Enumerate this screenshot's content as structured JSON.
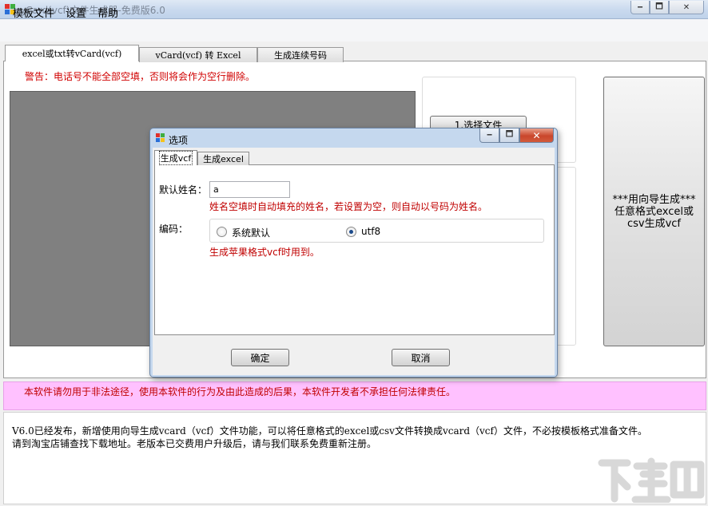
{
  "app": {
    "title": "vCard(vcf)文件生成器-免费版6.0"
  },
  "titlebar_buttons": {
    "minimize": "🗕",
    "maximize": "🗖",
    "close": "✕"
  },
  "menu": {
    "template": "模板文件",
    "settings": "设置",
    "help": "帮助"
  },
  "tabs": [
    {
      "label": "excel或txt转vCard(vcf)",
      "selected": true
    },
    {
      "label": "vCard(vcf) 转 Excel",
      "selected": false
    },
    {
      "label": "生成连续号码",
      "selected": false
    }
  ],
  "main": {
    "warning": "警告：电话号不能全部空填，否则将会作为空行删除。",
    "select_file_button": "1.选择文件",
    "wizard_button_lines": [
      "***用向导生成***",
      "任意格式excel或",
      "csv生成vcf"
    ]
  },
  "notice": "本软件请勿用于非法途径，使用本软件的行为及由此造成的后果，本软件开发者不承担任何法律责任。",
  "info": {
    "line1": "V6.0已经发布，新增使用向导生成vcard（vcf）文件功能，可以将任意格式的excel或csv文件转换成vcard（vcf）文件，不必按模板格式准备文件。",
    "line2": "请到淘宝店铺查找下载地址。老版本已交费用户升级后，请与我们联系免费重新注册。"
  },
  "dialog": {
    "title": "选项",
    "tabs": [
      {
        "label": "生成vcf",
        "selected": true
      },
      {
        "label": "生成excel",
        "selected": false
      }
    ],
    "default_name_label": "默认姓名：",
    "default_name_value": "a",
    "default_name_hint": "姓名空填时自动填充的姓名，若设置为空，则自动以号码为姓名。",
    "encoding_label": "编码：",
    "encoding_options": [
      {
        "label": "系统默认",
        "checked": false
      },
      {
        "label": "utf8",
        "checked": true
      }
    ],
    "apple_hint": "生成苹果格式vcf时用到。",
    "ok_button": "确定",
    "cancel_button": "取消"
  },
  "watermark": "下载吧",
  "colors": {
    "warning_red": "#d00000",
    "notice_bg": "#ffc1ff",
    "grid_gray": "#808080",
    "radio_dot": "#1c4a8a"
  },
  "icons": {
    "app": "app-windows-flag-icon",
    "dialog": "dialog-windows-flag-icon",
    "watermark": "watermark-logo"
  }
}
